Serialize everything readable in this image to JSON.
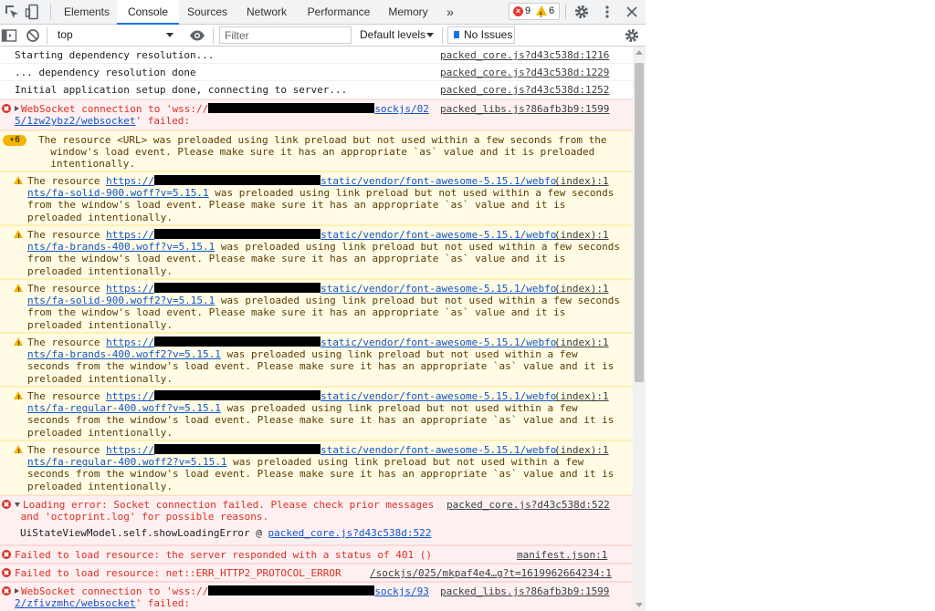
{
  "tabs": [
    {
      "label": "Elements"
    },
    {
      "label": "Console"
    },
    {
      "label": "Sources"
    },
    {
      "label": "Network"
    },
    {
      "label": "Performance"
    },
    {
      "label": "Memory"
    }
  ],
  "more_tabs_label": "»",
  "counts": {
    "errors": "9",
    "warnings": "6"
  },
  "toolbar": {
    "context": "top",
    "filter_placeholder": "Filter",
    "levels": "Default levels",
    "issues": "No Issues"
  },
  "messages": {
    "m1": {
      "text": "Starting dependency resolution...",
      "src": "packed_core.js?d43c538d:1216"
    },
    "m2": {
      "text": "... dependency resolution done",
      "src": "packed_core.js?d43c538d:1229"
    },
    "m3": {
      "text": "Initial application setup done, connecting to server...",
      "src": "packed_core.js?d43c538d:1252"
    },
    "e1": {
      "a": "WebSocket connection to 'wss://",
      "b": "sockjs/02",
      "c": "5/1zw2ybz2/websocket",
      "d": "' failed:",
      "src": "packed_libs.js?86afb3b9:1599"
    },
    "g": {
      "count": "6",
      "l1": "The resource <URL> was preloaded using link preload but not used within a few seconds from the",
      "l2": "window's load event. Please make sure it has an appropriate `as` value and it is preloaded",
      "l3": "intentionally."
    },
    "w1": {
      "pre": "The resource ",
      "url1": "https://",
      "url2": "static/vendor/font-awesome-5.15.1/webfo",
      "url3": "nts/fa-solid-900.woff?v=5.15.1",
      "t1": " was preloaded using link preload but not used within a few seconds",
      "l3": "from the window's load event. Please make sure it has an appropriate `as` value and it is",
      "l4": "preloaded intentionally.",
      "src": "(index):1"
    },
    "w2": {
      "pre": "The resource ",
      "url1": "https://",
      "url2": "static/vendor/font-awesome-5.15.1/webfo",
      "url3": "nts/fa-brands-400.woff?v=5.15.1",
      "t1": " was preloaded using link preload but not used within a few seconds",
      "l3": "from the window's load event. Please make sure it has an appropriate `as` value and it is",
      "l4": "preloaded intentionally.",
      "src": "(index):1"
    },
    "w3": {
      "pre": "The resource ",
      "url1": "https://",
      "url2": "static/vendor/font-awesome-5.15.1/webfo",
      "url3": "nts/fa-solid-900.woff2?v=5.15.1",
      "t1": " was preloaded using link preload but not used within a few seconds",
      "l3": "from the window's load event. Please make sure it has an appropriate `as` value and it is",
      "l4": "preloaded intentionally.",
      "src": "(index):1"
    },
    "w4": {
      "pre": "The resource ",
      "url1": "https://",
      "url2": "static/vendor/font-awesome-5.15.1/webfo",
      "url3": "nts/fa-brands-400.woff2?v=5.15.1",
      "t1": " was preloaded using link preload but not used within a few",
      "l3": "seconds from the window's load event. Please make sure it has an appropriate `as` value and it is",
      "l4": "preloaded intentionally.",
      "src": "(index):1"
    },
    "w5": {
      "pre": "The resource ",
      "url1": "https://",
      "url2": "static/vendor/font-awesome-5.15.1/webfo",
      "url3": "nts/fa-regular-400.woff?v=5.15.1",
      "t1": " was preloaded using link preload but not used within a few",
      "l3": "seconds from the window's load event. Please make sure it has an appropriate `as` value and it is",
      "l4": "preloaded intentionally.",
      "src": "(index):1"
    },
    "w6": {
      "pre": "The resource ",
      "url1": "https://",
      "url2": "static/vendor/font-awesome-5.15.1/webfo",
      "url3": "nts/fa-regular-400.woff2?v=5.15.1",
      "t1": " was preloaded using link preload but not used within a few",
      "l3": "seconds from the window's load event. Please make sure it has an appropriate `as` value and it is",
      "l4": "preloaded intentionally.",
      "src": "(index):1"
    },
    "e2": {
      "l1": "Loading error: Socket connection failed. Please check prior messages",
      "l2": "and 'octoprint.log' for possible reasons.",
      "stack": "UiStateViewModel.self.showLoadingError @ ",
      "stack_link": "packed_core.js?d43c538d:522",
      "src": "packed_core.js?d43c538d:522"
    },
    "e3": {
      "text": "Failed to load resource: the server responded with a status of 401 ()",
      "src": "manifest.json:1"
    },
    "e4": {
      "text": "Failed to load resource: net::ERR_HTTP2_PROTOCOL_ERROR",
      "src": "/sockjs/025/mkpaf4e4…g?t=1619962664234:1"
    },
    "e5": {
      "a": "WebSocket connection to 'wss://",
      "b": "sockjs/93",
      "c": "2/zfivzmhc/websocket",
      "d": "' failed:",
      "src": "packed_libs.js?86afb3b9:1599"
    }
  }
}
